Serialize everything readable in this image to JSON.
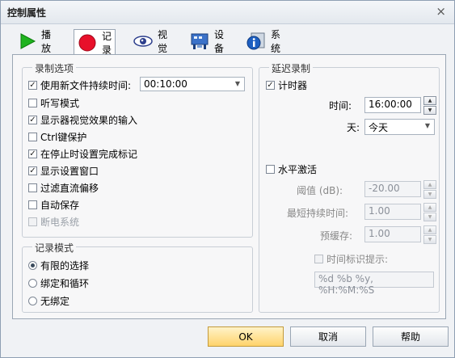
{
  "window": {
    "title": "控制属性",
    "close_glyph": "×"
  },
  "tabs": [
    {
      "label": "播放",
      "icon": "play-icon"
    },
    {
      "label": "记录",
      "icon": "record-icon",
      "active": true
    },
    {
      "label": "视觉",
      "icon": "eye-icon"
    },
    {
      "label": "设备",
      "icon": "device-icon"
    },
    {
      "label": "系统",
      "icon": "info-icon"
    }
  ],
  "record_options": {
    "legend": "录制选项",
    "items": [
      {
        "label": "使用新文件持续时间:",
        "checked": true
      },
      {
        "label": "听写模式",
        "checked": false
      },
      {
        "label": "显示器视觉效果的输入",
        "checked": true
      },
      {
        "label": "Ctrl键保护",
        "checked": false
      },
      {
        "label": "在停止时设置完成标记",
        "checked": true
      },
      {
        "label": "显示设置窗口",
        "checked": true
      },
      {
        "label": "过滤直流偏移",
        "checked": false
      },
      {
        "label": "自动保存",
        "checked": false
      },
      {
        "label": "断电系统",
        "checked": false,
        "disabled": true
      }
    ],
    "duration_value": "00:10:00"
  },
  "record_mode": {
    "legend": "记录模式",
    "options": [
      {
        "label": "有限的选择",
        "selected": true
      },
      {
        "label": "绑定和循环",
        "selected": false
      },
      {
        "label": "无绑定",
        "selected": false
      }
    ]
  },
  "delayed": {
    "legend": "延迟录制",
    "timer_label": "计时器",
    "timer_checked": true,
    "time_label": "时间:",
    "time_value": "16:00:00",
    "day_label": "天:",
    "day_value": "今天",
    "vox_label": "水平激活",
    "vox_checked": false,
    "threshold_label": "阈值 (dB):",
    "threshold_value": "-20.00",
    "min_duration_label": "最短持续时间:",
    "min_duration_value": "1.00",
    "prebuffer_label": "预缓存:",
    "prebuffer_value": "1.00",
    "timestamp_label": "时间标识提示:",
    "timestamp_checked": false,
    "timestamp_format": "%d %b %y, %H:%M:%S"
  },
  "buttons": {
    "ok": "OK",
    "cancel": "取消",
    "help": "帮助"
  },
  "glyphs": {
    "check": "✓",
    "up": "▲",
    "down": "▼",
    "drop": "▼"
  }
}
